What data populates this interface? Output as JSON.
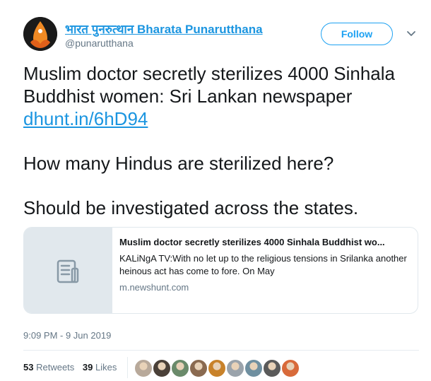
{
  "author": {
    "display_name": "भारत पुनरुत्थान Bharata Punarutthana",
    "handle": "@punarutthana",
    "avatar_icon": "saffron-lotus-logo-icon"
  },
  "follow_label": "Follow",
  "tweet": {
    "line1": "Muslim doctor secretly sterilizes 4000 Sinhala Buddhist women: Sri Lankan newspaper",
    "link": "dhunt.in/6hD94",
    "line2": "How many Hindus are sterilized here?",
    "line3": "Should be investigated across the states."
  },
  "card": {
    "title": "Muslim doctor secretly sterilizes 4000 Sinhala Buddhist wo...",
    "description": "KALiNgA TV:With no let up to the religious tensions in Srilanka another heinous act has come to fore. On May",
    "domain": "m.newshunt.com",
    "thumb_icon": "document-icon"
  },
  "timestamp": "9:09 PM - 9 Jun 2019",
  "stats": {
    "retweets_count": "53",
    "retweets_label": "Retweets",
    "likes_count": "39",
    "likes_label": "Likes"
  },
  "likers": [
    {
      "name": "liker-avatar-1",
      "color": "#b8a99a"
    },
    {
      "name": "liker-avatar-2",
      "color": "#4a4038"
    },
    {
      "name": "liker-avatar-3",
      "color": "#6a8a6a"
    },
    {
      "name": "liker-avatar-4",
      "color": "#8a6a50"
    },
    {
      "name": "liker-avatar-5",
      "color": "#c8822a"
    },
    {
      "name": "liker-avatar-6",
      "color": "#9aa3ab"
    },
    {
      "name": "liker-avatar-7",
      "color": "#6f8fa0"
    },
    {
      "name": "liker-avatar-8",
      "color": "#5a5a5a"
    },
    {
      "name": "liker-avatar-9",
      "color": "#d86a3a"
    }
  ],
  "colors": {
    "link": "#1b95e0",
    "follow": "#1da1f2",
    "muted": "#657786",
    "avatar_bg": "#1a1a1a",
    "logo_orange": "#f08a24"
  }
}
